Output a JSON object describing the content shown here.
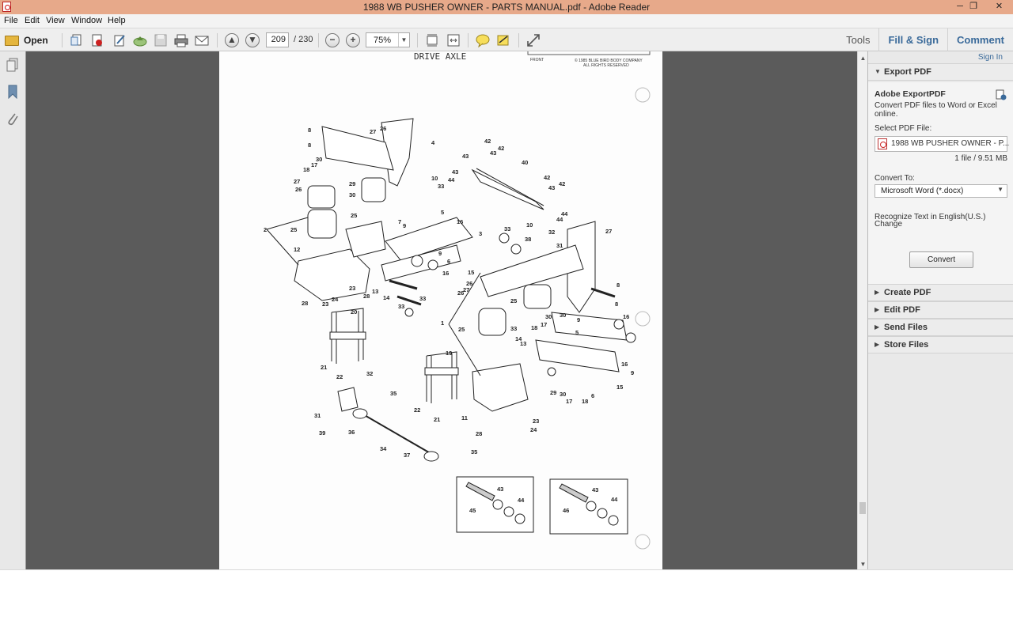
{
  "window": {
    "title": "1988 WB PUSHER OWNER - PARTS MANUAL.pdf - Adobe Reader",
    "minimize": "─",
    "maximize": "❐",
    "close": "✕"
  },
  "menu": {
    "file": "File",
    "edit": "Edit",
    "view": "View",
    "window": "Window",
    "help": "Help"
  },
  "toolbar": {
    "open_label": "Open",
    "page_current": "209",
    "page_total": "/ 230",
    "zoom": "75%",
    "zoom_out": "−",
    "zoom_in": "+",
    "prev_page": "▲",
    "next_page": "▼",
    "tools": "Tools",
    "fill_sign": "Fill & Sign",
    "comment": "Comment"
  },
  "document": {
    "heading": "DRIVE AXLE",
    "front_label": "FRONT",
    "copyright_line1": "© 1985 BLUE BIRD BODY COMPANY",
    "copyright_line2": "ALL RIGHTS RESERVED",
    "callouts": [
      "8",
      "8",
      "27",
      "26",
      "4",
      "30",
      "17",
      "18",
      "27",
      "26",
      "29",
      "30",
      "25",
      "10",
      "33",
      "7",
      "42",
      "42",
      "43",
      "43",
      "40",
      "43",
      "44",
      "42",
      "43",
      "42",
      "44",
      "44",
      "2",
      "25",
      "12",
      "9",
      "5",
      "16",
      "33",
      "38",
      "10",
      "32",
      "27",
      "3",
      "9",
      "6",
      "16",
      "15",
      "31",
      "26",
      "27",
      "26",
      "8",
      "25",
      "8",
      "23",
      "23",
      "24",
      "28",
      "13",
      "14",
      "33",
      "33",
      "28",
      "20",
      "16",
      "33",
      "18",
      "17",
      "30",
      "30",
      "9",
      "5",
      "25",
      "1",
      "14",
      "13",
      "19",
      "29",
      "30",
      "17",
      "18",
      "16",
      "15",
      "9",
      "6",
      "21",
      "22",
      "32",
      "35",
      "31",
      "39",
      "36",
      "22",
      "21",
      "11",
      "28",
      "23",
      "24",
      "34",
      "37",
      "35",
      "43",
      "44",
      "45",
      "43",
      "44",
      "46"
    ]
  },
  "right_panel": {
    "sign_in": "Sign In",
    "export_header": "Export PDF",
    "adobe_export_title": "Adobe ExportPDF",
    "adobe_export_desc_1": "Convert PDF files to Word or Excel",
    "adobe_export_desc_2": "online.",
    "select_pdf_label": "Select PDF File:",
    "file_name": "1988 WB PUSHER OWNER - P...",
    "file_info": "1 file / 9.51 MB",
    "convert_to_label": "Convert To:",
    "convert_to_value": "Microsoft Word (*.docx)",
    "recognize_text": "Recognize Text in English(U.S.)",
    "change_link": "Change",
    "convert_button": "Convert",
    "sections": [
      "Create PDF",
      "Edit PDF",
      "Send Files",
      "Store Files"
    ]
  },
  "icons": {
    "open": "folder-icon",
    "create": "create-pdf-icon",
    "edit": "edit-icon",
    "cloud": "cloud-upload-icon",
    "save": "save-icon",
    "print": "print-icon",
    "email": "email-icon",
    "comment": "comment-icon",
    "sign": "sign-icon",
    "expand": "expand-icon"
  }
}
